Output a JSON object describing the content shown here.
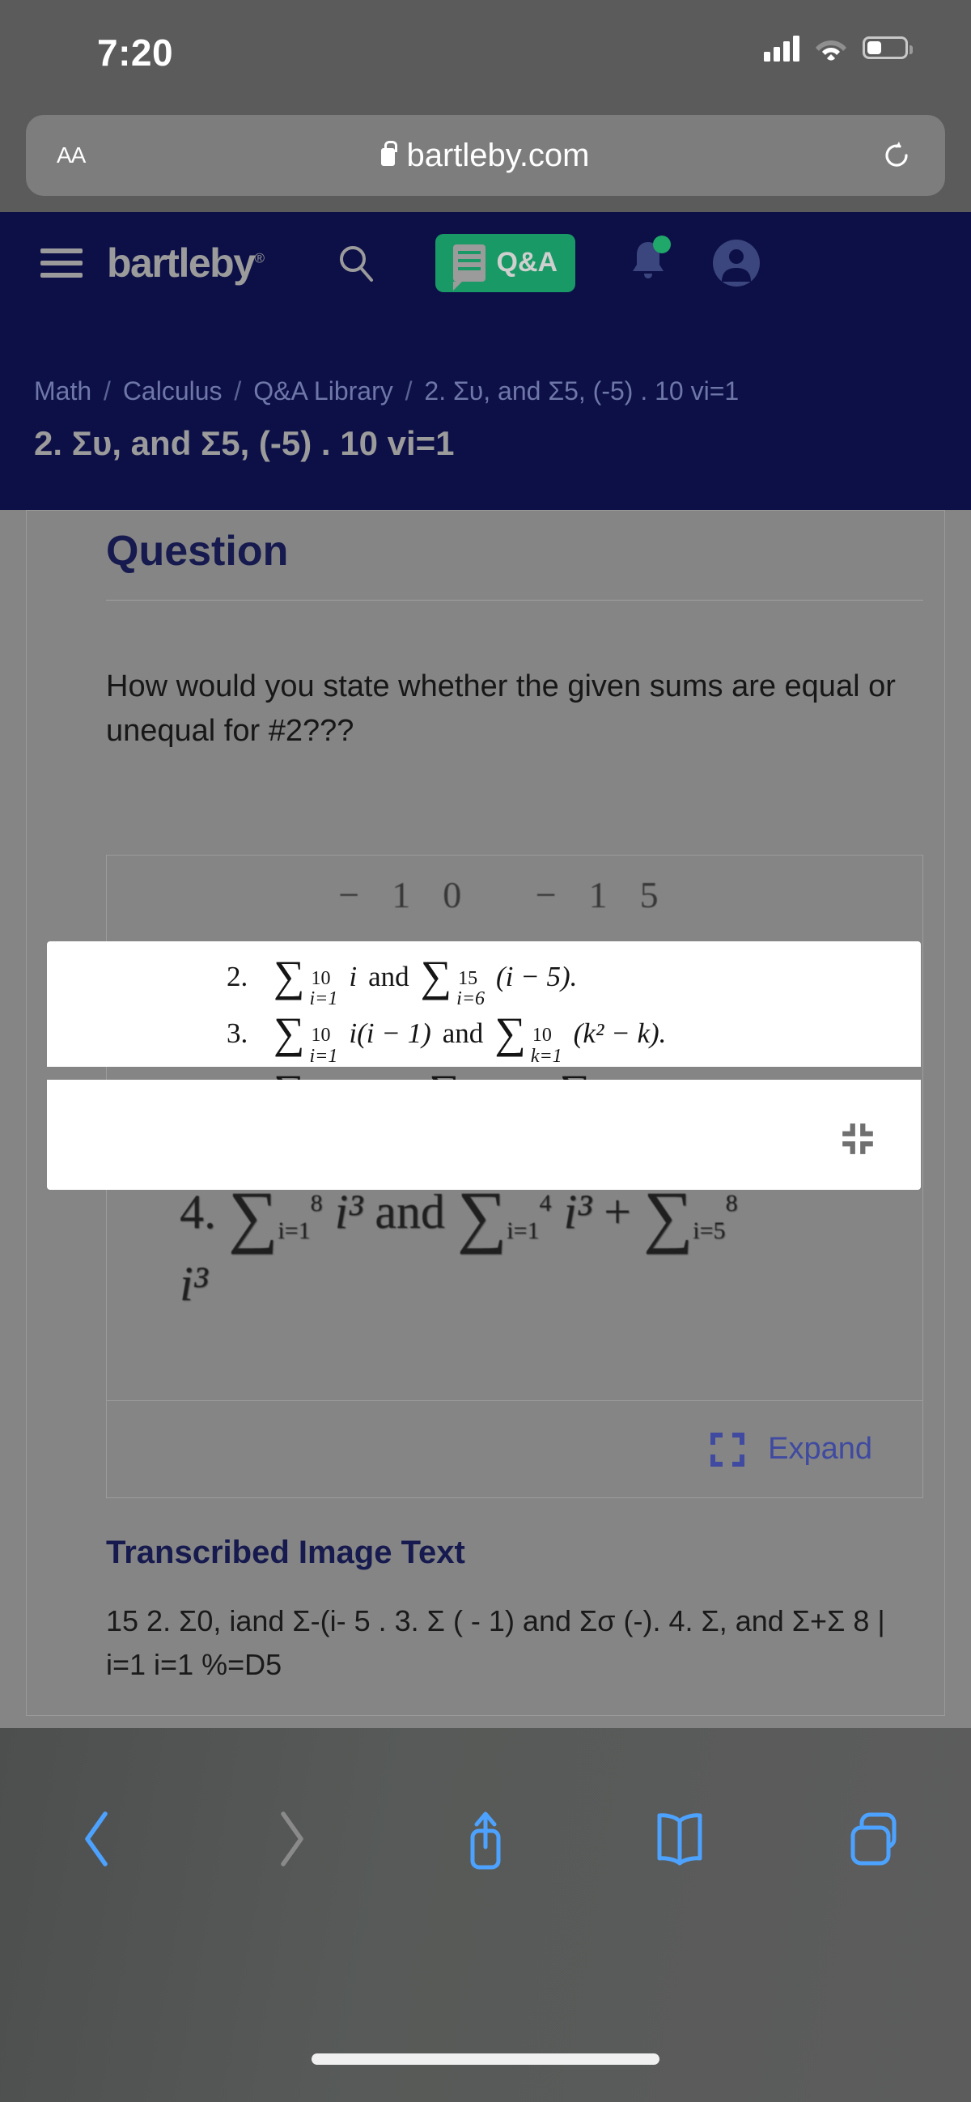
{
  "status_bar": {
    "time": "7:20",
    "cellular_icon": "cellular-signal-icon",
    "wifi_icon": "wifi-icon",
    "battery_icon": "battery-icon"
  },
  "browser": {
    "aa_label": "AA",
    "lock_icon": "lock-icon",
    "url": "bartleby.com",
    "reload_icon": "reload-icon",
    "toolbar": {
      "back_icon": "back-chevron-icon",
      "forward_icon": "forward-chevron-icon",
      "share_icon": "share-icon",
      "bookmarks_icon": "book-icon",
      "tabs_icon": "tabs-icon",
      "home_indicator": "home-indicator"
    }
  },
  "site_header": {
    "menu_icon": "hamburger-menu-icon",
    "logo_text": "bartleby",
    "logo_trademark": "®",
    "search_icon": "search-icon",
    "qa_button_label": "Q&A",
    "qa_doc_icon": "document-chat-icon",
    "bell_icon": "notification-bell-icon",
    "bell_has_badge": true,
    "account_icon": "account-avatar-icon",
    "bg_color": "#0d1047",
    "qa_accent_color": "#199965"
  },
  "breadcrumb": {
    "items": [
      "Math",
      "Calculus",
      "Q&A Library",
      "2. Συ, and Σ5, (-5) . 10 vi=1"
    ],
    "separator": "/"
  },
  "page": {
    "title": "2. Συ, and Σ5, (-5) . 10 vi=1"
  },
  "question_section": {
    "heading": "Question",
    "body": "How would you state whether the given sums are equal or unequal for #2???"
  },
  "image_block": {
    "partial_top_line": "−10      −15",
    "visible_formula": {
      "number": "4.",
      "left_sigma_upper": "8",
      "left_sigma_lower": "i=1",
      "left_term": "i³",
      "connector": "and",
      "mid_sigma_upper": "4",
      "mid_sigma_lower": "i=1",
      "mid_term": "i³",
      "plus": "+",
      "right_sigma_upper": "8",
      "right_sigma_lower": "i=5",
      "right_term": "i³"
    },
    "expand_label": "Expand",
    "expand_icon": "expand-corners-icon"
  },
  "overlay": {
    "collapse_icon": "collapse-corners-icon",
    "rows": [
      {
        "number": "2.",
        "parts": [
          {
            "sigma_upper": "10",
            "sigma_lower": "i=1",
            "term": "i"
          },
          {
            "connector": "and"
          },
          {
            "sigma_upper": "15",
            "sigma_lower": "i=6",
            "term": "(i − 5)."
          }
        ]
      },
      {
        "number": "3.",
        "parts": [
          {
            "sigma_upper": "10",
            "sigma_lower": "i=1",
            "term": "i(i − 1)"
          },
          {
            "connector": "and"
          },
          {
            "sigma_upper": "10",
            "sigma_lower": "k=1",
            "term": "(k² − k)."
          }
        ]
      },
      {
        "number": "4.",
        "parts": [
          {
            "sigma_upper": "8",
            "sigma_lower": "i=1",
            "term": "i³"
          },
          {
            "connector": "and"
          },
          {
            "sigma_upper": "4",
            "sigma_lower": "i=1",
            "term": "i³"
          },
          {
            "connector": "+"
          },
          {
            "sigma_upper": "8",
            "sigma_lower": "i=5",
            "term": "i³"
          }
        ]
      }
    ],
    "row2_text": "2.  ∑ i and ∑ (i − 5).",
    "row3_text": "3.  ∑ i(i − 1) and ∑ (k² − k).",
    "row4_text": "4.  ∑ i³ and ∑ i³ + ∑ i³"
  },
  "transcribed": {
    "heading": "Transcribed Image Text",
    "body": "15 2. Σ0, iand Σ-(i- 5 . 3. Σ ( - 1) and Σσ (-). 4. Σ, and Σ+Σ 8 | i=1 i=1 %=D5"
  },
  "tutor_fab": {
    "icon": "chat-tutor-icon",
    "color": "#2e4691"
  }
}
